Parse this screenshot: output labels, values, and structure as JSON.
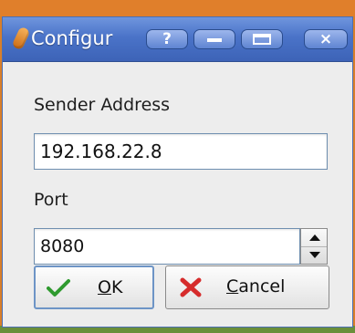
{
  "window": {
    "title": "Configur",
    "buttons": {
      "help": "?",
      "minimize": "minimize",
      "maximize": "maximize",
      "close": "×"
    }
  },
  "form": {
    "sender_label": "Sender Address",
    "sender_value": "192.168.22.8",
    "port_label": "Port",
    "port_value": "8080"
  },
  "actions": {
    "ok_mnemonic": "O",
    "ok_rest": "K",
    "cancel_mnemonic": "C",
    "cancel_rest": "ancel"
  },
  "colors": {
    "titlebar": "#4a73c8",
    "ok_icon": "#2f9a2f",
    "cancel_icon": "#d62c2c"
  },
  "icons": {
    "app": "app-icon",
    "ok": "check-icon",
    "cancel": "x-icon"
  }
}
